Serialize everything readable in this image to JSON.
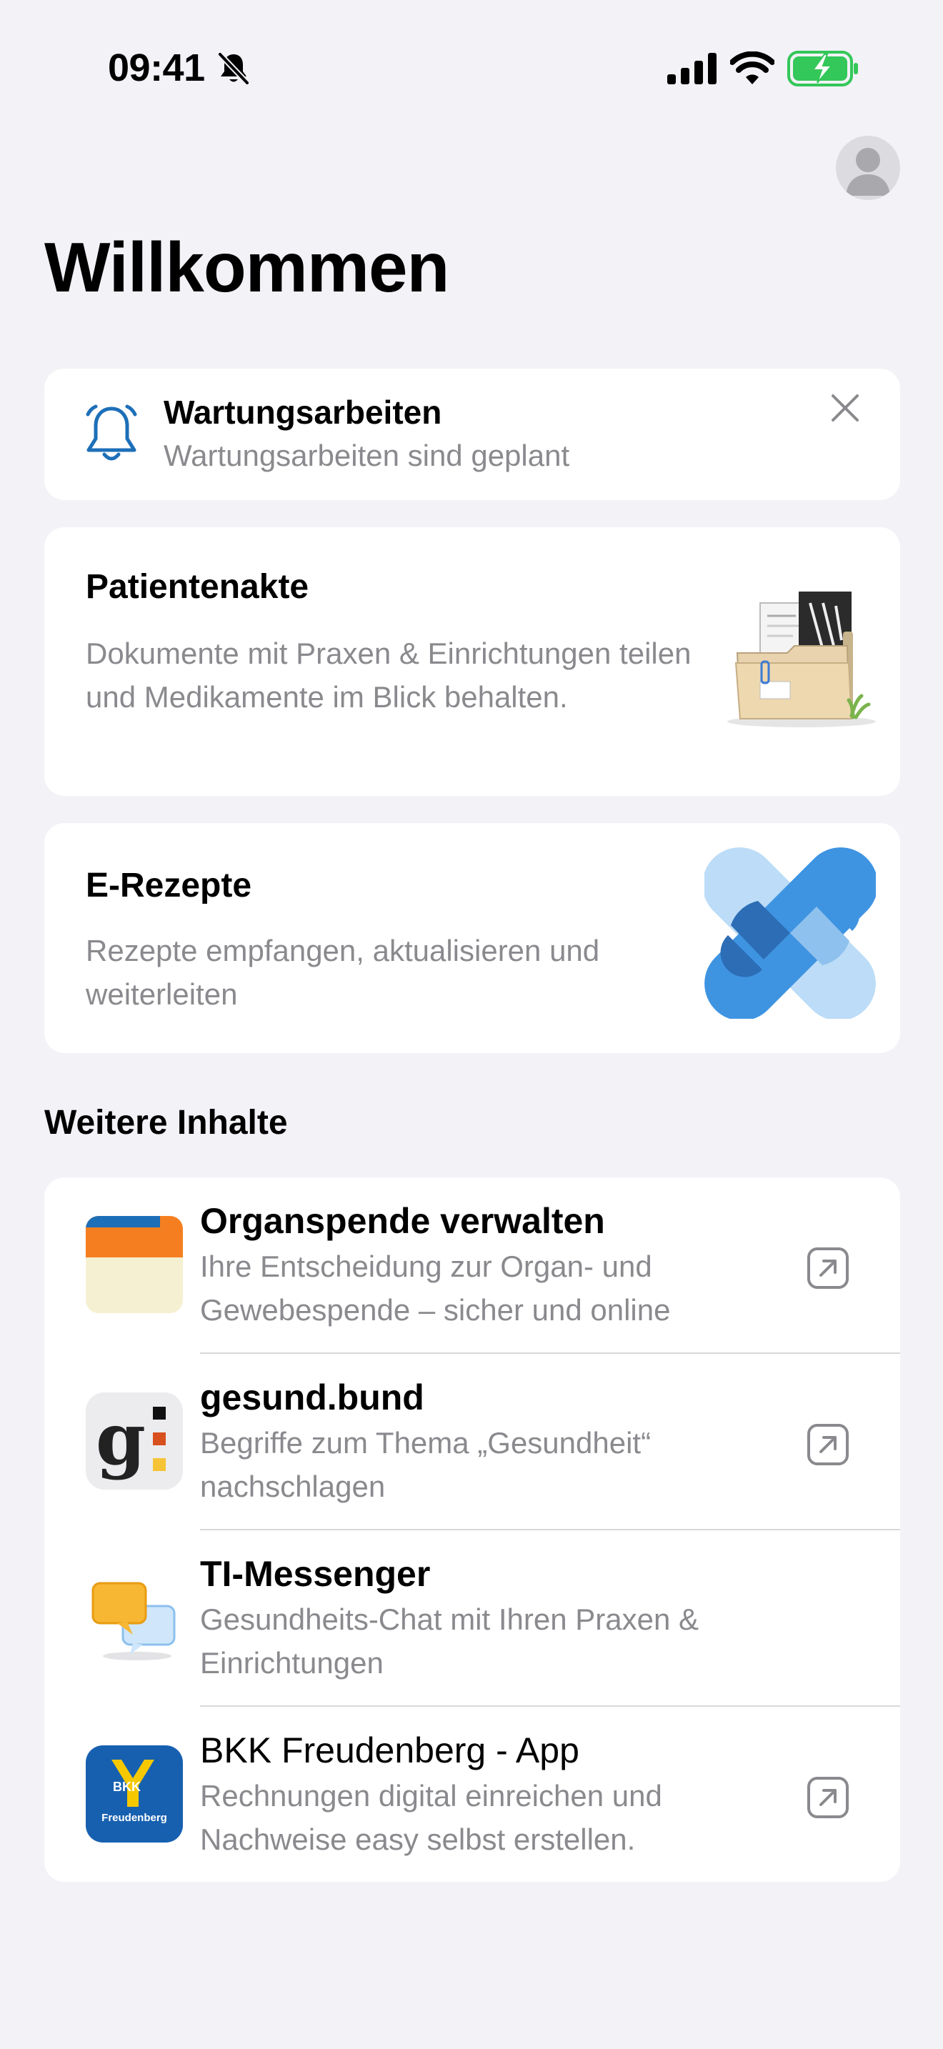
{
  "status_bar": {
    "time": "09:41"
  },
  "header": {
    "title": "Willkommen"
  },
  "notice": {
    "title": "Wartungsarbeiten",
    "subtitle": "Wartungsarbeiten sind geplant"
  },
  "features": [
    {
      "title": "Patientenakte",
      "description": "Dokumente mit Praxen & Einrichtungen teilen und Medikamente im Blick behalten."
    },
    {
      "title": "E-Rezepte",
      "description": "Rezepte empfangen, aktualisieren und weiterleiten"
    }
  ],
  "more_section": {
    "title": "Weitere Inhalte",
    "items": [
      {
        "title": "Organspende verwalten",
        "description": "Ihre Entscheidung zur Organ- und Gewebespende – sicher und online",
        "icon": "organ-donation-icon"
      },
      {
        "title": "gesund.bund",
        "description": "Begriffe zum Thema „Gesundheit“ nachschlagen",
        "icon": "gesund-bund-logo",
        "logo_text": "g"
      },
      {
        "title": "TI-Messenger",
        "description": "Gesundheits-Chat mit Ihren Praxen & Einrichtungen",
        "icon": "chat-bubbles-icon"
      },
      {
        "title": "BKK Freudenberg - App",
        "description": "Rechnungen digital einreichen und Nachweise easy selbst erstellen.",
        "icon": "bkk-freudenberg-logo",
        "logo_text_top": "BKK",
        "logo_text_bottom": "Freudenberg"
      }
    ]
  },
  "colors": {
    "background": "#f2f2f7",
    "accent_blue": "#1d6fb8",
    "battery_green": "#34c759",
    "secondary_text": "#8a8a8e"
  }
}
